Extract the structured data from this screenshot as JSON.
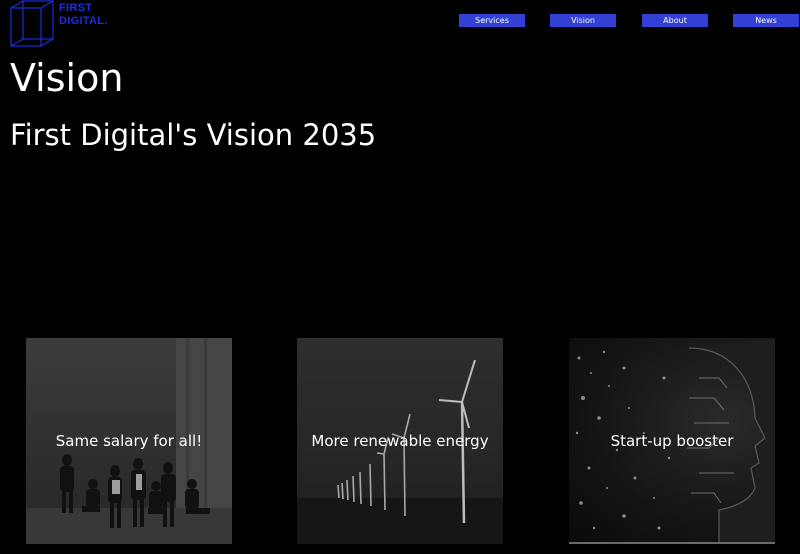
{
  "logo": {
    "line1": "FIRST",
    "line2": "DIGITAL."
  },
  "nav": {
    "items": [
      "Services",
      "Vision",
      "About",
      "News"
    ]
  },
  "page": {
    "title": "Vision",
    "subtitle": "First Digital's Vision 2035"
  },
  "cards": [
    {
      "label": "Same salary for all!",
      "image": "group-of-women-photo"
    },
    {
      "label": "More renewable energy",
      "image": "wind-turbines-photo"
    },
    {
      "label": "Start-up booster",
      "image": "digital-head-photo"
    }
  ],
  "colors": {
    "background": "#000000",
    "nav_button": "#3340d6",
    "logo": "#1a2fe0",
    "text": "#ffffff"
  }
}
